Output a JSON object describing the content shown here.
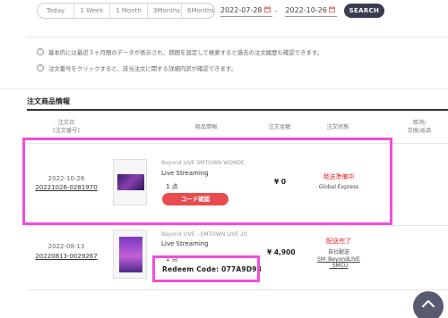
{
  "filter": {
    "periods": [
      "Today",
      "1 Week",
      "1 Month",
      "3Months",
      "6Months"
    ],
    "date_from": "2022-07-28",
    "date_to": "2022-10-26",
    "date_separator": "-",
    "search_label": "SEARCH"
  },
  "notices": [
    "基本的には最近３ヶ月間のデータが表示され、期間を設定して検索すると過去の注文履歴も確認できます。",
    "注文番号をクリックすると、該当注文に関する詳細内訳が確認できます。"
  ],
  "section_title": "注文商品情報",
  "table": {
    "headers": {
      "date": "注文日",
      "order_no": "[注文番号]",
      "product": "商品情報",
      "amount": "注文金額",
      "status": "注文状態",
      "cancel": "取消/",
      "exchange": "交換/返品"
    },
    "rows": [
      {
        "date": "2022-10-26",
        "order_no": "20221026-0281970",
        "subtitle": "Beyond LIVE SMTOWN WONDE",
        "name": "Live Streaming",
        "qty": "1 点",
        "button": "コード確認",
        "price": "¥ 0",
        "status": "発送準備中",
        "status_sub": "Global Express"
      },
      {
        "date": "2022-08-13",
        "order_no": "20220813-0029267",
        "subtitle": "Beyond LIVE - SMTOWN LIVE 20",
        "name": "Live Streaming",
        "qty": "1 点",
        "redeem": "Redeem Code: 077A9D98",
        "price": "¥ 4,900",
        "status": "配送完了",
        "status_sub": "自社配送",
        "status_link_1": "SM_BeyondLIVE",
        "status_link_2": "_SMCU"
      }
    ]
  },
  "colors": {
    "highlight": "#f04ddb",
    "accent_red": "#e84c4f",
    "search_button": "#3a3d52",
    "scroll_top": "#585a70"
  },
  "icons": {
    "calendar": "calendar-icon",
    "info": "info-icon",
    "scroll_top": "chevron-up-icon"
  }
}
